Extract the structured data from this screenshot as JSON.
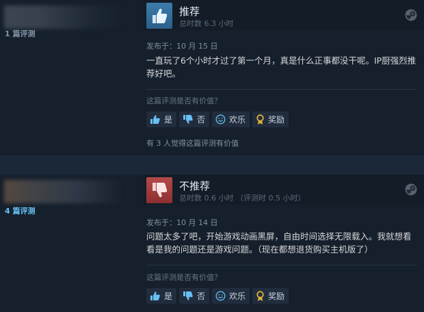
{
  "reviews": [
    {
      "review_count": "1 篇评测",
      "verdict": "推荐",
      "playtime": "总时数 6.3 小时",
      "posted": "发布于：10 月 15 日",
      "body": "一直玩了6个小时才过了第一个月，真是什么正事都没干呢。IP厨强烈推荐好吧。",
      "helpful_question": "这篇评测是否有价值？",
      "buttons": {
        "yes": "是",
        "no": "否",
        "funny": "欢乐",
        "award": "奖励"
      },
      "helpful_count": "有 3 人觉得这篇评测有价值"
    },
    {
      "review_count": "4 篇评测",
      "verdict": "不推荐",
      "playtime": "总时数 0.6 小时 （评测时 0.5 小时）",
      "posted": "发布于：10 月 14 日",
      "body": "问题太多了吧，开始游戏动画黑屏，自由时间选择无限载入。我就想看看是我的问题还是游戏问题。（现在都想退货购买主机版了）",
      "helpful_question": "这篇评测是否有价值？",
      "buttons": {
        "yes": "是",
        "no": "否",
        "funny": "欢乐",
        "award": "奖励"
      }
    }
  ],
  "colors": {
    "background": "#1b2838",
    "review_bg": "#16202d",
    "accent_blue": "#66c0f4",
    "recommend": "#3d7cab",
    "not_recommend": "#b44a4a"
  },
  "icons": [
    "thumbs-up-icon",
    "thumbs-down-icon",
    "steam-logo-icon",
    "smile-icon",
    "award-icon"
  ]
}
